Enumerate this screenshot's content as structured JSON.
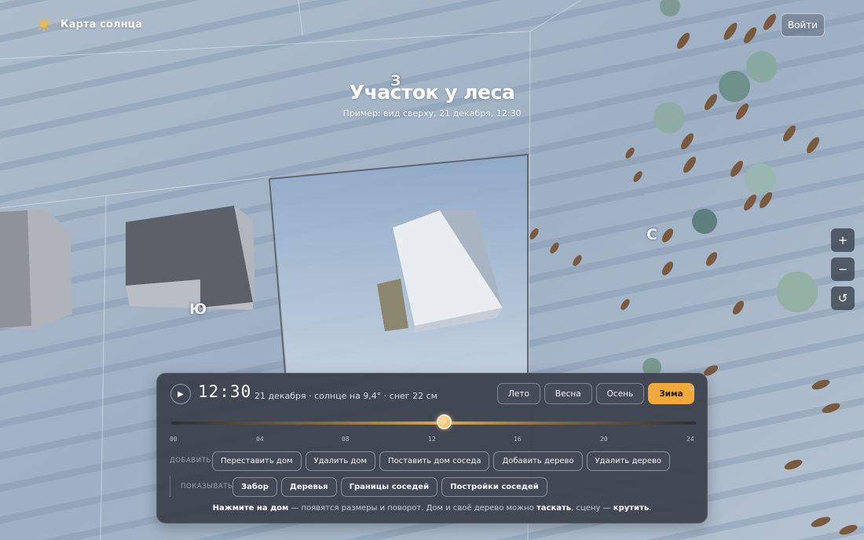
{
  "app": {
    "title": "Карта солнца",
    "login_label": "Войти"
  },
  "scene": {
    "title": "Участок у леса",
    "subtitle": "Пример: вид сверху, 21 декабря, 12:30",
    "compass": {
      "west": "З",
      "east": "С",
      "south": "Ю"
    }
  },
  "map_controls": {
    "zoom_in": "+",
    "zoom_out": "−",
    "reset": "↺"
  },
  "panel": {
    "play_icon": "▶",
    "time": "12:30",
    "status": "21 декабря · солнце на 9,4° · снег 22 см",
    "seasons": [
      {
        "label": "Лето",
        "active": false
      },
      {
        "label": "Весна",
        "active": false
      },
      {
        "label": "Осень",
        "active": false
      },
      {
        "label": "Зима",
        "active": true
      }
    ],
    "collapse_icon": "v",
    "timeline": {
      "ticks": [
        "00",
        "04",
        "08",
        "12",
        "16",
        "20",
        "24"
      ],
      "value_hours": 12.5,
      "min": 0,
      "max": 24
    },
    "add_row": {
      "label": "ДОБАВИТЬ",
      "buttons": [
        "Переставить дом",
        "Удалить дом",
        "Поставить дом соседа",
        "Добавить дерево",
        "Удалить дерево"
      ]
    },
    "show_row": {
      "label": "ПОКАЗЫВАТЬ",
      "toggles": [
        "Забор",
        "Деревья",
        "Границы соседей",
        "Постройки соседей"
      ]
    },
    "hint": {
      "part1": "Нажмите на дом",
      "part2": " — появятся размеры и поворот. Дом и своё дерево можно ",
      "part3": "таскать",
      "part4": ", сцену — ",
      "part5": "крутить",
      "part6": "."
    }
  }
}
